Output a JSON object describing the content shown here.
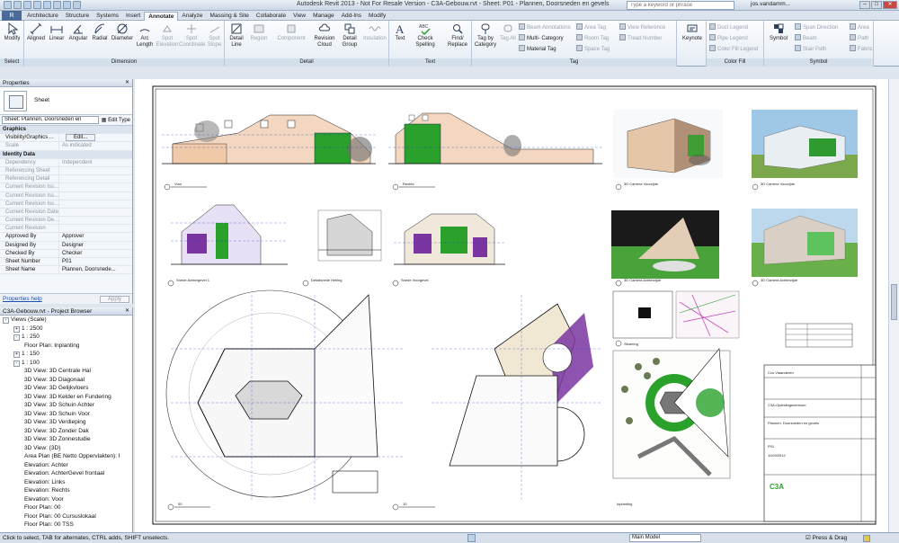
{
  "window": {
    "title": "Autodesk Revit 2013 - Not For Resale Version - C3A-Gebouw.rvt - Sheet: P01 - Plannen, Doorsneden en gevels",
    "search_placeholder": "Type a keyword or phrase",
    "user": "jos.vandamm..."
  },
  "ribbon": {
    "tabs": [
      "Architecture",
      "Structure",
      "Systems",
      "Insert",
      "Annotate",
      "Analyze",
      "Massing & Site",
      "Collaborate",
      "View",
      "Manage",
      "Add-Ins",
      "Modify"
    ],
    "active_tab": "Annotate",
    "groups": {
      "select": "Select",
      "dimension": "Dimension",
      "detail": "Detail",
      "text": "Text",
      "tag": "Tag",
      "color_fill": "Color Fill",
      "symbol": "Symbol"
    },
    "buttons": {
      "modify": "Modify",
      "aligned": "Aligned",
      "linear": "Linear",
      "angular": "Angular",
      "radial": "Radial",
      "diameter": "Diameter",
      "arc_length": "Arc Length",
      "spot_elevation": "Spot Elevation",
      "spot_coordinate": "Spot Coordinate",
      "spot_slope": "Spot Slope",
      "detail_line": "Detail Line",
      "region": "Region",
      "component": "Component",
      "revision_cloud": "Revision Cloud",
      "detail_group": "Detail Group",
      "insulation": "Insulation",
      "text": "Text",
      "check_spelling": "Check Spelling",
      "find_replace": "Find/ Replace",
      "tag_by_category": "Tag by Category",
      "tag_all": "Tag All",
      "beam_annotations": "Beam Annotations",
      "multi_category": "Multi- Category",
      "material_tag": "Material Tag",
      "area_tag": "Area Tag",
      "room_tag": "Room Tag",
      "space_tag": "Space Tag",
      "view_reference": "View Reference",
      "tread_number": "Tread Number",
      "keynote": "Keynote",
      "duct_legend": "Duct Legend",
      "pipe_legend": "Pipe Legend",
      "color_fill_legend": "Color Fill Legend",
      "symbol": "Symbol",
      "span_direction": "Span Direction",
      "beam": "Beam",
      "stair_path": "Stair Path",
      "area": "Area",
      "path": "Path",
      "fabric": "Fabric"
    }
  },
  "properties": {
    "title": "Properties",
    "type_name": "Sheet",
    "instance_selector": "Sheet: Plannen, Doorsneden en",
    "edit_type": "Edit Type",
    "rows": [
      {
        "k": "Graphics",
        "v": "",
        "cat": true
      },
      {
        "k": "Visibility/Graphics ...",
        "v": "Edit...",
        "btn": true
      },
      {
        "k": "Scale",
        "v": "As indicated",
        "dim": true
      },
      {
        "k": "Identity Data",
        "v": "",
        "cat": true
      },
      {
        "k": "Dependency",
        "v": "Independent",
        "dim": true
      },
      {
        "k": "Referencing Sheet",
        "v": "",
        "dim": true
      },
      {
        "k": "Referencing Detail",
        "v": "",
        "dim": true
      },
      {
        "k": "Current Revision Iss...",
        "v": "",
        "dim": true
      },
      {
        "k": "Current Revision Iss...",
        "v": "",
        "dim": true
      },
      {
        "k": "Current Revision Iss...",
        "v": "",
        "dim": true
      },
      {
        "k": "Current Revision Date",
        "v": "",
        "dim": true
      },
      {
        "k": "Current Revision De...",
        "v": "",
        "dim": true
      },
      {
        "k": "Current Revision",
        "v": "",
        "dim": true
      },
      {
        "k": "Approved By",
        "v": "Approver"
      },
      {
        "k": "Designed By",
        "v": "Designer"
      },
      {
        "k": "Checked By",
        "v": "Checker"
      },
      {
        "k": "Sheet Number",
        "v": "P01"
      },
      {
        "k": "Sheet Name",
        "v": "Plannen, Doorsnede..."
      }
    ],
    "help_link": "Properties help",
    "apply": "Apply"
  },
  "browser": {
    "title": "C3A-Gebouw.rvt - Project Browser",
    "items": [
      {
        "label": "Views (Scale)",
        "depth": 0,
        "tog": "-"
      },
      {
        "label": "1 : 2500",
        "depth": 1,
        "tog": "+"
      },
      {
        "label": "1 : 250",
        "depth": 1,
        "tog": "-"
      },
      {
        "label": "Floor Plan: Inplanting",
        "depth": 2
      },
      {
        "label": "1 : 150",
        "depth": 1,
        "tog": "+"
      },
      {
        "label": "1 : 100",
        "depth": 1,
        "tog": "-"
      },
      {
        "label": "3D View: 3D Centrale Hal",
        "depth": 2
      },
      {
        "label": "3D View: 3D Diagonaal",
        "depth": 2
      },
      {
        "label": "3D View: 3D Gelijkvloers",
        "depth": 2
      },
      {
        "label": "3D View: 3D Kelder en Fundering",
        "depth": 2
      },
      {
        "label": "3D View: 3D Schuin Achter",
        "depth": 2
      },
      {
        "label": "3D View: 3D Schuin Voor",
        "depth": 2
      },
      {
        "label": "3D View: 3D Verdieping",
        "depth": 2
      },
      {
        "label": "3D View: 3D Zonder Dak",
        "depth": 2
      },
      {
        "label": "3D View: 3D Zonnestudie",
        "depth": 2
      },
      {
        "label": "3D View: {3D}",
        "depth": 2
      },
      {
        "label": "Area Plan (BE Netto Oppervlakten): I",
        "depth": 2
      },
      {
        "label": "Elevation: Achter",
        "depth": 2
      },
      {
        "label": "Elevation: AchterGevel frontaal",
        "depth": 2
      },
      {
        "label": "Elevation: Links",
        "depth": 2
      },
      {
        "label": "Elevation: Rechts",
        "depth": 2
      },
      {
        "label": "Elevation: Voor",
        "depth": 2
      },
      {
        "label": "Floor Plan: 00",
        "depth": 2
      },
      {
        "label": "Floor Plan: 00 Cursuslokaal",
        "depth": 2
      },
      {
        "label": "Floor Plan: 00 TSS",
        "depth": 2
      }
    ]
  },
  "sheet": {
    "view_titles": {
      "voor": "Voor",
      "rechts": "Rechts",
      "cam_voor": "3D Camera Voorzijde",
      "cam_voor2": "3D Camera Voorzijde",
      "snede_a": "Snede Achtergevel 1",
      "snede_detail": "Detailsnede Helling",
      "snede_b": "Snede Voorgevel",
      "cam_achter": "3D Camera Achterzijde",
      "cam_achter2": "3D Camera Achterzijde",
      "plan_00": "00",
      "plan_10": "10",
      "situering": "Situering",
      "inplanting": "Inplanting"
    },
    "titleblock": {
      "school": "Cvo Vlaanderen",
      "project": "C3A-Opleidingscentrum",
      "sheet_name": "Plannen, Doorsneden en gevels",
      "sheet_number": "P01",
      "date": "11/09/2012",
      "logo": "C3A"
    }
  },
  "statusbar": {
    "message": "Click to select, TAB for alternates, CTRL adds, SHIFT unselects.",
    "active_model": "Main Model",
    "press_drag": "Press & Drag"
  },
  "colors": {
    "ribbon_bg": "#e9eff6",
    "accent_green": "#2aa12a",
    "accent_purple": "#7a35a0",
    "link_blue": "#1a4fb0"
  }
}
